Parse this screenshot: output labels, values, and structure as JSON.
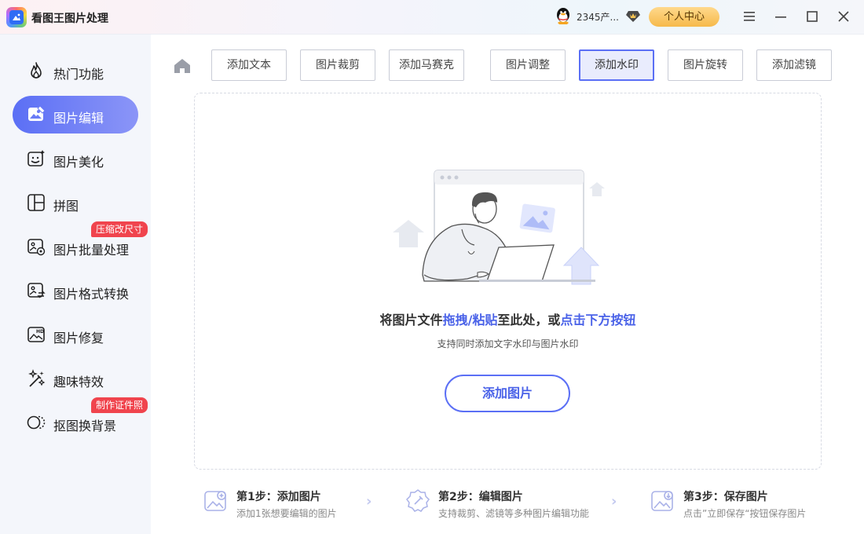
{
  "app": {
    "title": "看图王图片处理"
  },
  "header": {
    "user_name": "2345产...",
    "center_label": "个人中心"
  },
  "sidebar": {
    "items": [
      {
        "label": "热门功能",
        "icon": "flame-icon"
      },
      {
        "label": "图片编辑",
        "icon": "image-edit-icon",
        "active": true
      },
      {
        "label": "图片美化",
        "icon": "image-sparkle-icon"
      },
      {
        "label": "拼图",
        "icon": "collage-icon"
      },
      {
        "label": "图片批量处理",
        "icon": "batch-image-icon",
        "badge": "压缩改尺寸"
      },
      {
        "label": "图片格式转换",
        "icon": "format-convert-icon"
      },
      {
        "label": "图片修复",
        "icon": "hd-image-icon"
      },
      {
        "label": "趣味特效",
        "icon": "magic-wand-icon"
      },
      {
        "label": "抠图换背景",
        "icon": "cutout-icon",
        "badge": "制作证件照"
      }
    ]
  },
  "toolbar": {
    "tools": [
      {
        "label": "添加文本"
      },
      {
        "label": "图片裁剪"
      },
      {
        "label": "添加马赛克"
      },
      {
        "label": "图片调整"
      },
      {
        "label": "添加水印",
        "active": true
      },
      {
        "label": "图片旋转"
      },
      {
        "label": "添加滤镜"
      }
    ]
  },
  "dropzone": {
    "title_part1": "将图片文件",
    "title_hl1": "拖拽/粘贴",
    "title_part2": "至此处，或",
    "title_hl2": "点击下方按钮",
    "subtitle": "支持同时添加文字水印与图片水印",
    "add_button": "添加图片"
  },
  "steps": [
    {
      "title": "第1步：添加图片",
      "desc": "添加1张想要编辑的图片"
    },
    {
      "title": "第2步：编辑图片",
      "desc": "支持裁剪、滤镜等多种图片编辑功能"
    },
    {
      "title": "第3步：保存图片",
      "desc": "点击”立即保存“按钮保存图片"
    }
  ],
  "colors": {
    "accent": "#5b6ff5",
    "highlight_text": "#4a62e8",
    "badge": "#f0444d",
    "center_button": "#f6b94a"
  }
}
